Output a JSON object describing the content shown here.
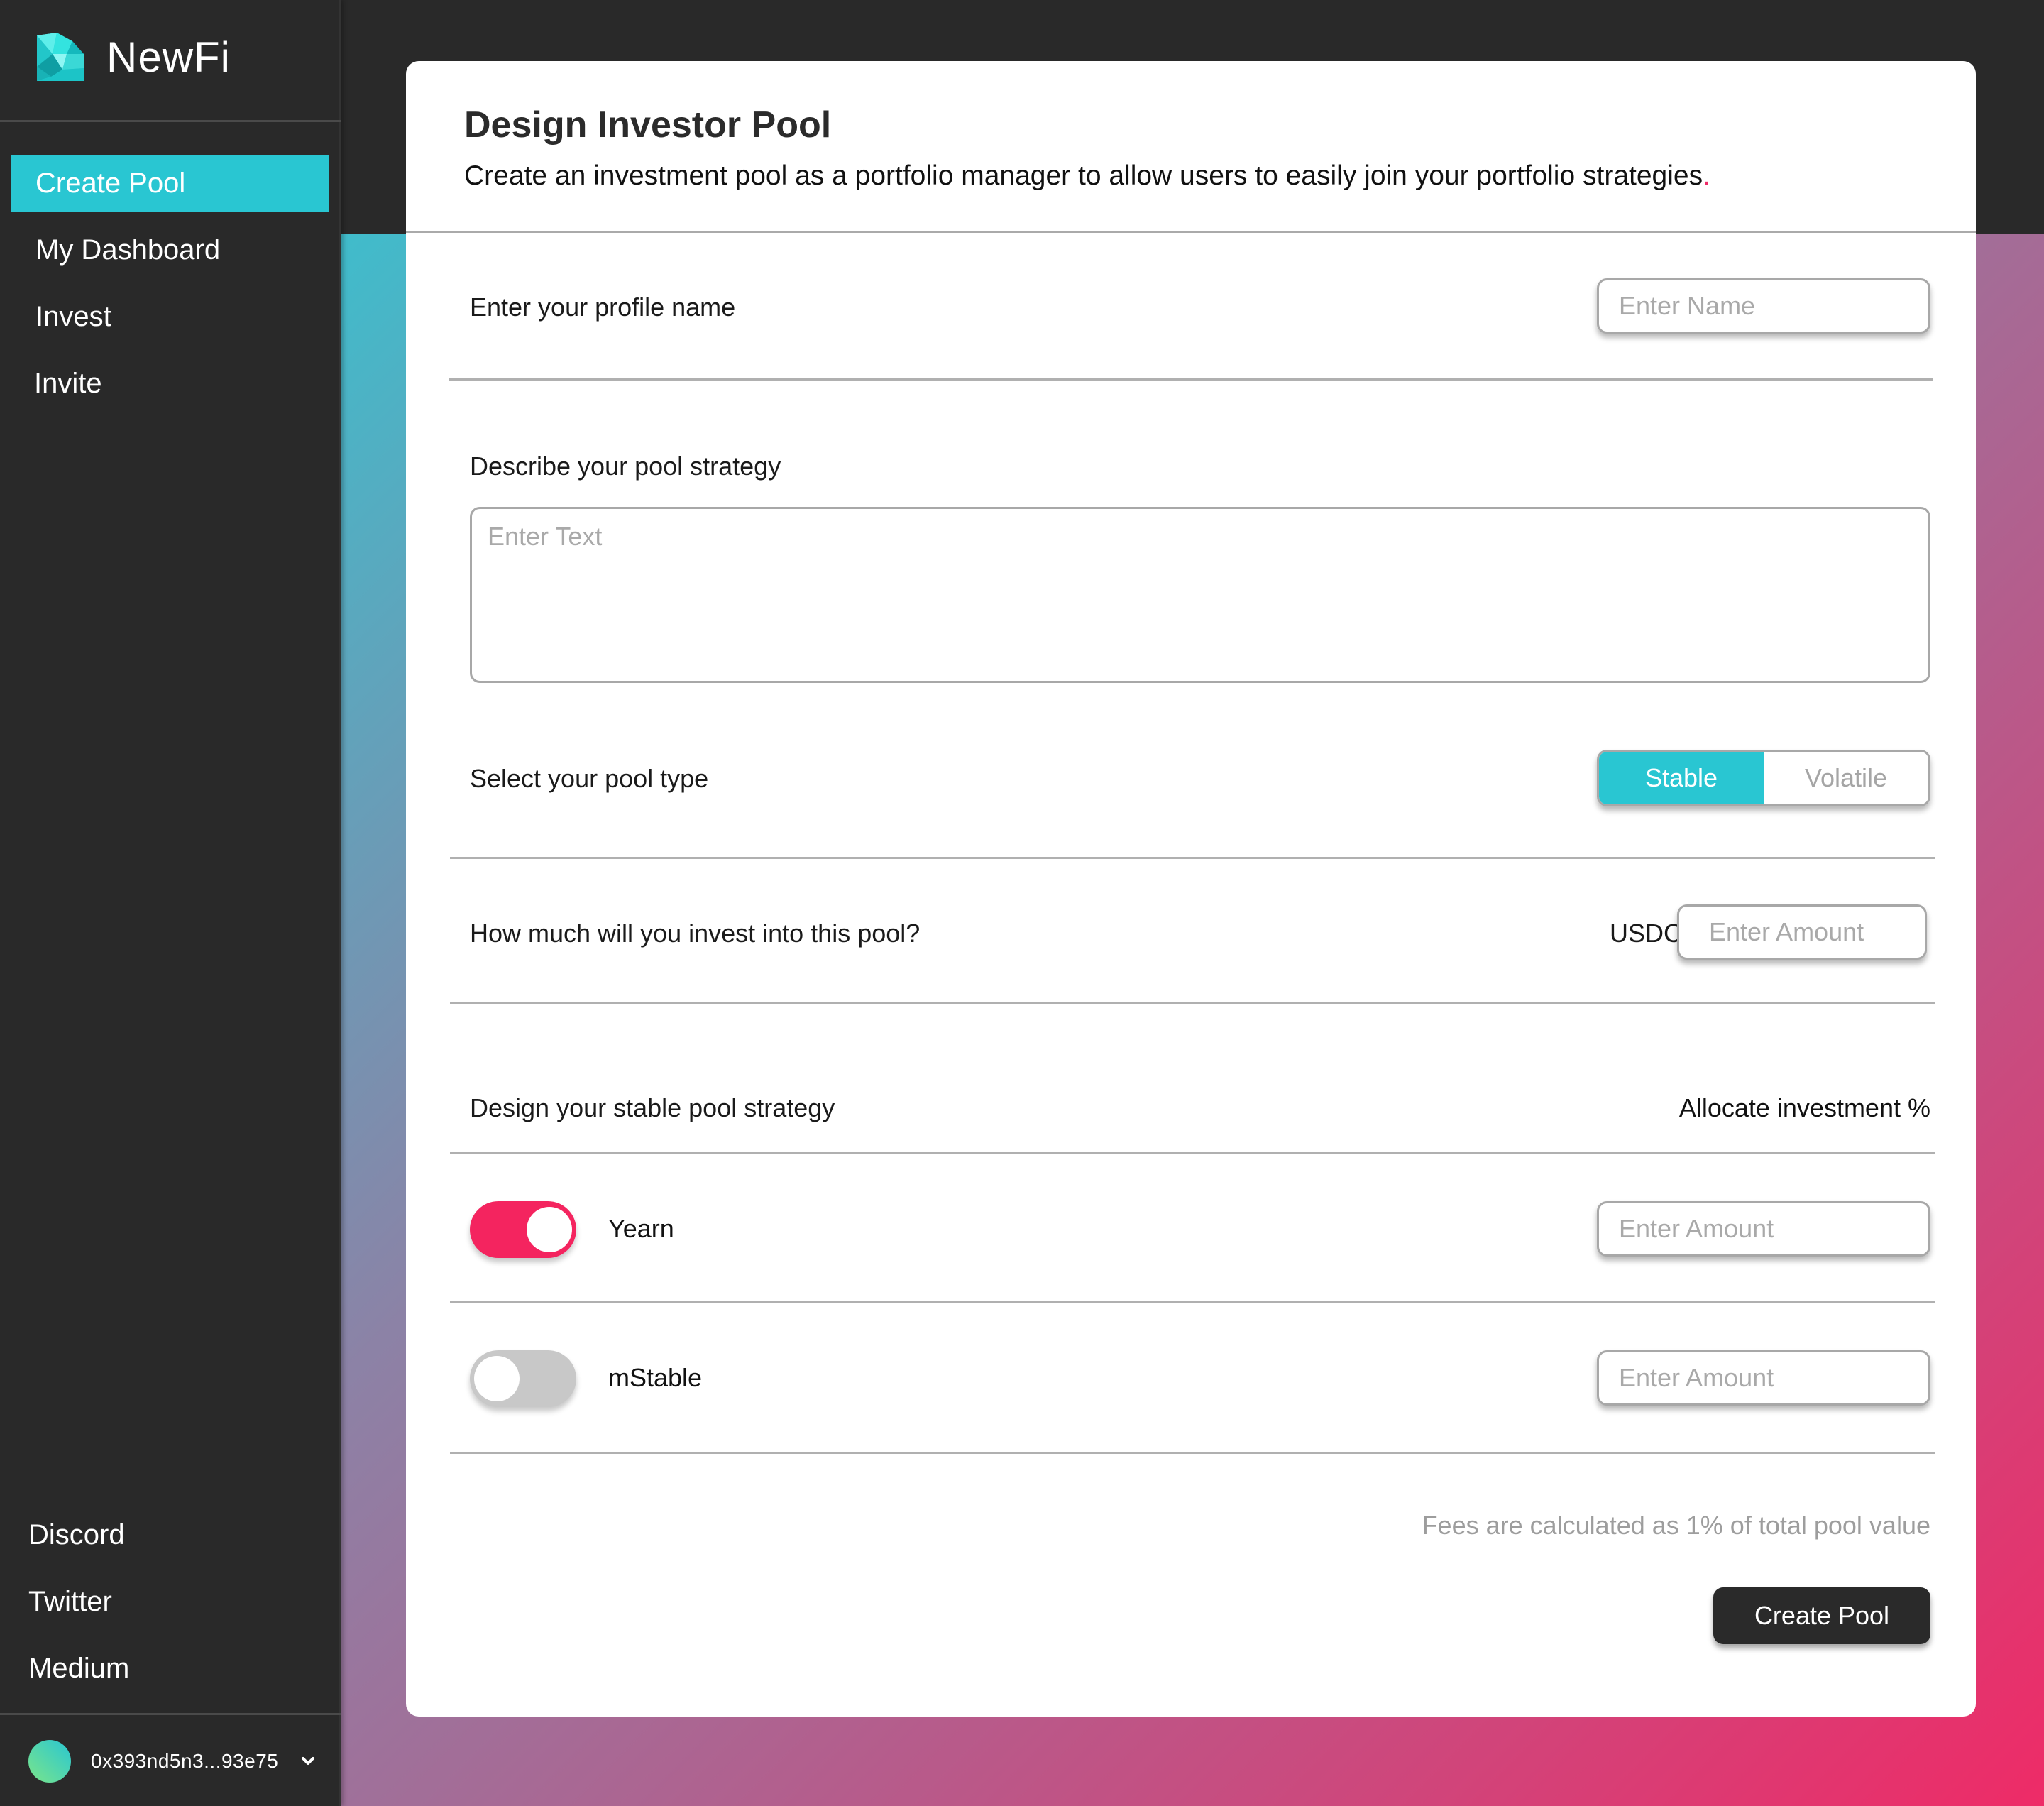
{
  "app": {
    "name": "NewFi",
    "logo_icon": "diamond-icon",
    "colors": {
      "accent_teal": "#29c6d2",
      "accent_pink": "#f4245f",
      "sidebar_bg": "#292929",
      "gradient_start": "#40bccb",
      "gradient_end": "#ee2b67"
    }
  },
  "sidebar": {
    "nav_items": [
      {
        "label": "Create Pool",
        "active": true
      },
      {
        "label": "My Dashboard",
        "active": false
      },
      {
        "label": "Invite",
        "active": false
      }
    ],
    "nav_invest": {
      "label": "Invest",
      "active": false
    },
    "social_links": [
      {
        "label": "Discord"
      },
      {
        "label": "Twitter"
      },
      {
        "label": "Medium"
      }
    ],
    "wallet": {
      "address": "0x393nd5n3...93e75",
      "dropdown_icon": "chevron-down-icon"
    }
  },
  "card": {
    "title": "Design Investor Pool",
    "subtitle": "Create an investment pool as a portfolio manager to allow users to easily join your portfolio strategies",
    "subtitle_end": "."
  },
  "form": {
    "profile": {
      "label": "Enter your profile name",
      "placeholder": "Enter Name",
      "value": ""
    },
    "strategy_description": {
      "label": "Describe your pool strategy",
      "placeholder": "Enter Text",
      "value": ""
    },
    "pool_type": {
      "label": "Select your pool type",
      "options": [
        "Stable",
        "Volatile"
      ],
      "selected": "Stable"
    },
    "investment": {
      "label": "How much will you invest into this pool?",
      "currency": "USDC",
      "placeholder": "Enter Amount",
      "value": ""
    },
    "stable_strategy": {
      "label": "Design your stable pool strategy",
      "allocation_header": "Allocate investment %",
      "protocols": [
        {
          "name": "Yearn",
          "enabled": true,
          "placeholder": "Enter Amount",
          "value": ""
        },
        {
          "name": "mStable",
          "enabled": false,
          "placeholder": "Enter Amount",
          "value": ""
        }
      ]
    },
    "fees_note": "Fees are calculated as 1% of total pool value",
    "submit_label": "Create Pool"
  }
}
